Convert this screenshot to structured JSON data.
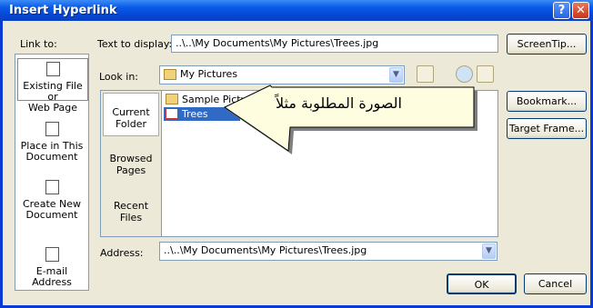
{
  "window": {
    "title": "Insert Hyperlink",
    "help_glyph": "?",
    "close_glyph": "✕"
  },
  "link_to": {
    "label": "Link to:",
    "items": [
      {
        "label_line1": "Existing File or",
        "label_line2": "Web Page",
        "selected": true
      },
      {
        "label_line1": "Place in This",
        "label_line2": "Document",
        "selected": false
      },
      {
        "label_line1": "Create New",
        "label_line2": "Document",
        "selected": false
      },
      {
        "label_line1": "E-mail Address",
        "label_line2": "",
        "selected": false
      }
    ]
  },
  "text_to_display": {
    "label": "Text to display:",
    "value": "..\\..\\My Documents\\My Pictures\\Trees.jpg"
  },
  "screentip_button": "ScreenTip...",
  "look_in": {
    "label": "Look in:",
    "value": "My Pictures"
  },
  "browse_tabs": [
    {
      "line1": "Current",
      "line2": "Folder",
      "selected": true
    },
    {
      "line1": "Browsed",
      "line2": "Pages",
      "selected": false
    },
    {
      "line1": "Recent",
      "line2": "Files",
      "selected": false
    }
  ],
  "files": [
    {
      "name": "Sample Pictures",
      "type": "folder",
      "selected": false
    },
    {
      "name": "Trees",
      "type": "image",
      "selected": true
    }
  ],
  "callout": {
    "text": "الصورة المطلوبة مثلاً",
    "bg": "#fffde0"
  },
  "side_buttons": {
    "bookmark": "Bookmark...",
    "target_frame": "Target Frame..."
  },
  "address": {
    "label": "Address:",
    "value": "..\\..\\My Documents\\My Pictures\\Trees.jpg"
  },
  "ok_button": "OK",
  "cancel_button": "Cancel",
  "colors": {
    "title_bar": "#0a5be8",
    "selection": "#316ac5",
    "dialog_bg": "#ece9d8"
  }
}
